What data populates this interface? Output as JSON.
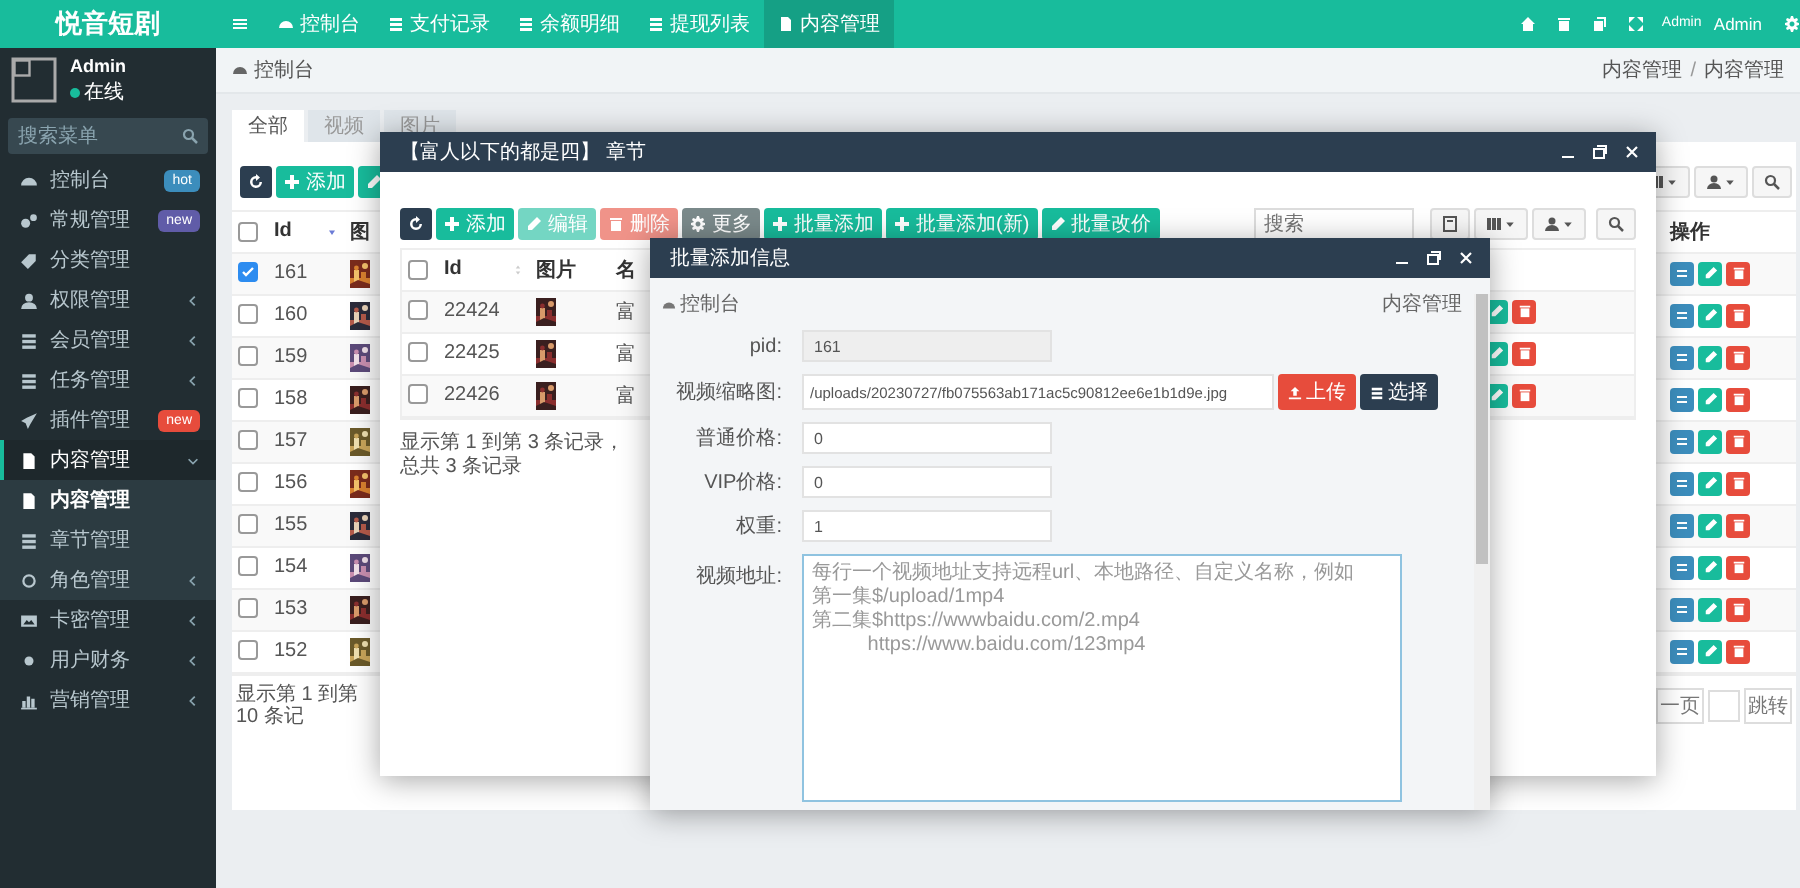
{
  "sidebar": {
    "brand": "悦音短剧",
    "user": {
      "name": "Admin",
      "status": "在线"
    },
    "search": {
      "placeholder": "搜索菜单"
    },
    "menu": [
      {
        "label": "控制台",
        "selected": false,
        "badge": {
          "text": "hot",
          "color": "#3c8dbc"
        }
      },
      {
        "label": "常规管理",
        "selected": false,
        "badge": {
          "text": "new",
          "color": "#605ca8"
        }
      },
      {
        "label": "分类管理",
        "selected": false
      },
      {
        "label": "权限管理",
        "selected": false,
        "expanded": false
      },
      {
        "label": "会员管理",
        "selected": false,
        "expanded": false
      },
      {
        "label": "任务管理",
        "selected": false,
        "expanded": false
      },
      {
        "label": "插件管理",
        "selected": false,
        "badge": {
          "text": "new",
          "color": "#e74c3c"
        }
      },
      {
        "label": "内容管理",
        "selected": true,
        "expanded": true,
        "children": [
          {
            "label": "内容管理",
            "selected": true
          },
          {
            "label": "章节管理",
            "selected": false
          },
          {
            "label": "角色管理",
            "selected": false,
            "expanded": false
          }
        ]
      },
      {
        "label": "卡密管理",
        "selected": false,
        "expanded": false
      },
      {
        "label": "用户财务",
        "selected": false,
        "expanded": false
      },
      {
        "label": "营销管理",
        "selected": false,
        "expanded": false
      }
    ]
  },
  "topbar": {
    "tabs": [
      {
        "label": "控制台",
        "selected": false
      },
      {
        "label": "支付记录",
        "selected": false
      },
      {
        "label": "余额明细",
        "selected": false
      },
      {
        "label": "提现列表",
        "selected": false
      },
      {
        "label": "内容管理",
        "selected": true
      }
    ],
    "avatar_alt": "Admin",
    "user": "Admin"
  },
  "breadcrumb": {
    "home": "控制台",
    "trail": [
      "内容管理",
      "内容管理"
    ],
    "separator": "/"
  },
  "list_panel": {
    "tabs": [
      {
        "label": "全部",
        "selected": true
      },
      {
        "label": "视频",
        "selected": false
      },
      {
        "label": "图片",
        "selected": false
      }
    ],
    "toolbar": [
      {
        "kind": "refresh"
      },
      {
        "kind": "add",
        "label": "添加"
      },
      {
        "kind": "edit"
      }
    ],
    "select_all": {
      "checked": false
    },
    "columns": [
      "Id",
      "图"
    ],
    "action_column": "操作",
    "rows": [
      {
        "id": "161",
        "checked": true
      },
      {
        "id": "160",
        "checked": false
      },
      {
        "id": "159",
        "checked": false
      },
      {
        "id": "158",
        "checked": false
      },
      {
        "id": "157",
        "checked": false
      },
      {
        "id": "156",
        "checked": false
      },
      {
        "id": "155",
        "checked": false
      },
      {
        "id": "154",
        "checked": false
      },
      {
        "id": "153",
        "checked": false
      },
      {
        "id": "152",
        "checked": false
      }
    ],
    "footer": "显示第 1 到第 10 条记",
    "pagination": {
      "prev": "一页",
      "jump": "跳转"
    }
  },
  "chapter_window": {
    "title": "【富人以下的都是四】 章节",
    "toolbar": [
      {
        "kind": "refresh",
        "disabled": false
      },
      {
        "kind": "add",
        "label": "添加",
        "disabled": false
      },
      {
        "kind": "edit",
        "label": "编辑",
        "disabled": true
      },
      {
        "kind": "delete",
        "label": "删除",
        "disabled": true
      },
      {
        "kind": "more",
        "label": "更多",
        "disabled": false
      },
      {
        "kind": "add",
        "label": "批量添加",
        "disabled": false
      },
      {
        "kind": "add",
        "label": "批量添加(新)",
        "disabled": false
      },
      {
        "kind": "price",
        "label": "批量改价",
        "disabled": false
      }
    ],
    "search": {
      "placeholder": "搜索"
    },
    "select_all": {
      "checked": false
    },
    "columns": [
      "Id",
      "图片",
      "名"
    ],
    "rows": [
      {
        "id": "22424",
        "checked": false,
        "name": "富"
      },
      {
        "id": "22425",
        "checked": false,
        "name": "富"
      },
      {
        "id": "22426",
        "checked": false,
        "name": "富"
      }
    ],
    "footer": "显示第 1 到第 3 条记录，总共 3 条记录"
  },
  "form_window": {
    "title": "批量添加信息",
    "breadcrumb": {
      "home": "控制台",
      "current": "内容管理"
    },
    "fields": [
      {
        "kind": "text",
        "label": "pid:",
        "value": "161",
        "disabled": true
      },
      {
        "kind": "upload",
        "label": "视频缩略图:",
        "value": "/uploads/20230727/fb075563ab171ac5c90812ee6e1b1d9e.jpg",
        "upload": "上传",
        "choose": "选择",
        "disabled": false
      },
      {
        "kind": "text",
        "label": "普通价格:",
        "value": "0",
        "disabled": false
      },
      {
        "kind": "text",
        "label": "VIP价格:",
        "value": "0",
        "disabled": false
      },
      {
        "kind": "text",
        "label": "权重:",
        "value": "1",
        "disabled": false
      },
      {
        "kind": "textarea",
        "label": "视频地址:",
        "placeholder": [
          "每行一个视频地址支持远程url、本地路径、自定义名称，例如",
          "第一集$/upload/1mp4",
          "第二集$https://wwwbaidu.com/2.mp4",
          "          https://www.baidu.com/123mp4"
        ],
        "disabled": false
      }
    ]
  }
}
